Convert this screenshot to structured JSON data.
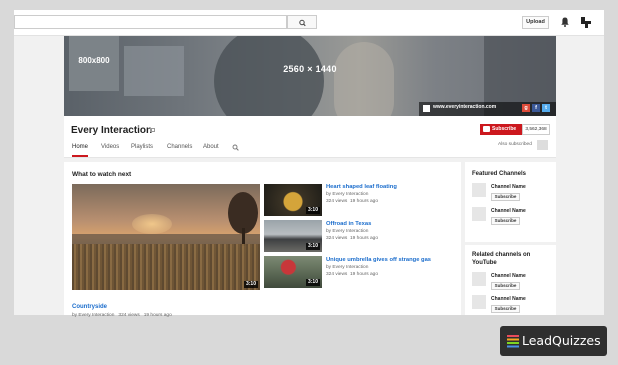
{
  "topbar": {
    "search_placeholder": "",
    "upload_label": "Upload",
    "icons": [
      "search-icon",
      "bell-icon",
      "account-icon"
    ]
  },
  "banner": {
    "avatar_size_text": "800x800",
    "banner_size_text": "2560 × 1440",
    "url": "www.everyinteraction.com",
    "social": [
      "g+",
      "f",
      "t",
      "ig"
    ]
  },
  "channel": {
    "title": "Every Interaction",
    "subscribe_label": "Subscribe",
    "subscriber_count": "3,562,368",
    "also_subscribed": "Also subscribed",
    "tabs": [
      "Home",
      "Videos",
      "Playlists",
      "Channels",
      "About"
    ],
    "active_tab": "Home"
  },
  "main": {
    "heading": "What to watch next",
    "feature": {
      "title": "Countryside",
      "channel": "by Every Interaction",
      "views": "324 views",
      "age": "19 hours ago",
      "duration": "3:10"
    },
    "videos": [
      {
        "title": "Heart shaped leaf floating",
        "channel": "by Every Interaction",
        "views": "324 views",
        "age": "19 hours ago",
        "duration": "3:10"
      },
      {
        "title": "Offroad in Texas",
        "channel": "by Every Interaction",
        "views": "324 views",
        "age": "19 hours ago",
        "duration": "3:10"
      },
      {
        "title": "Unique umbrella gives off strange gas",
        "channel": "by Every Interaction",
        "views": "324 views",
        "age": "19 hours ago",
        "duration": "3:10"
      }
    ]
  },
  "featured": {
    "title": "Featured Channels",
    "channels": [
      {
        "name": "Channel Name",
        "subscribe": "Subscribe"
      },
      {
        "name": "Channel Name",
        "subscribe": "Subscribe"
      }
    ]
  },
  "related": {
    "title": "Related channels on YouTube",
    "channels": [
      {
        "name": "Channel Name",
        "subscribe": "Subscribe"
      },
      {
        "name": "Channel Name",
        "subscribe": "Subscribe"
      }
    ]
  },
  "brand": {
    "name": "LeadQuizzes",
    "accent": "#cc181e",
    "link": "#1b6dcc"
  }
}
